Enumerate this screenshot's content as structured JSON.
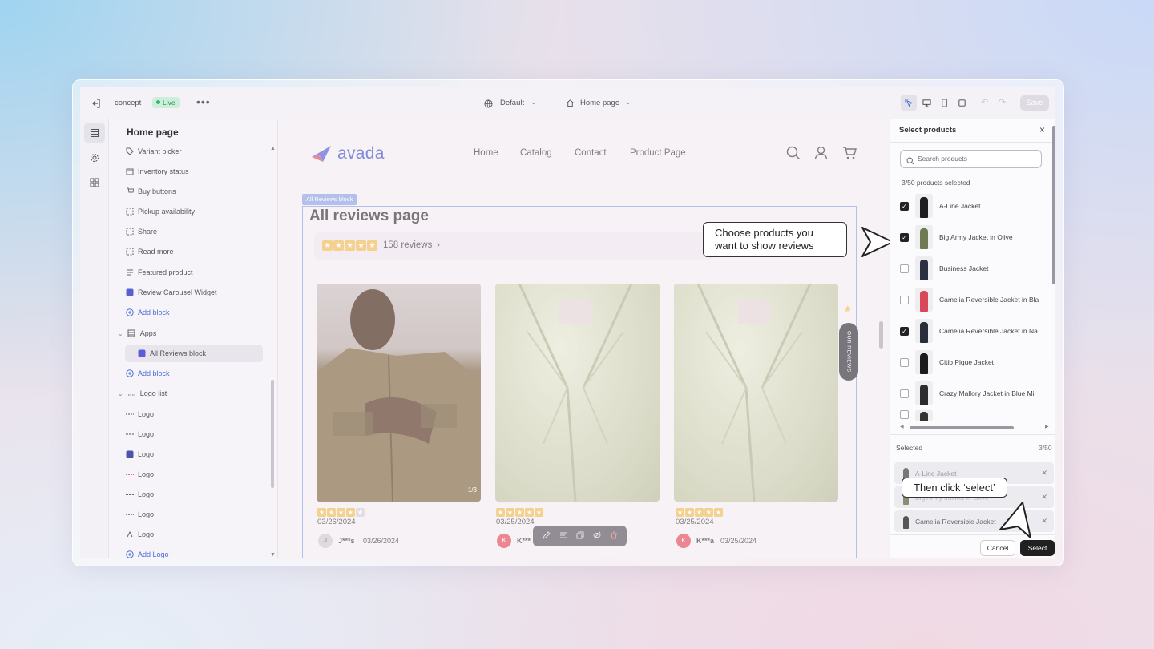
{
  "topbar": {
    "store_name": "concept",
    "live_badge": "Live",
    "more": "•••",
    "theme_select": "Default",
    "page_select": "Home page",
    "save_label": "Save"
  },
  "tree": {
    "title": "Home page",
    "items": [
      {
        "label": "Variant picker",
        "icon": "tag-icon"
      },
      {
        "label": "Inventory status",
        "icon": "box-icon"
      },
      {
        "label": "Buy buttons",
        "icon": "cart-icon"
      },
      {
        "label": "Pickup availability",
        "icon": "dashed-square-icon"
      },
      {
        "label": "Share",
        "icon": "dashed-square-icon"
      },
      {
        "label": "Read more",
        "icon": "dashed-square-icon"
      },
      {
        "label": "Featured product",
        "icon": "lines-icon"
      },
      {
        "label": "Review Carousel Widget",
        "icon": "app-icon"
      },
      {
        "label": "Add block",
        "icon": "plus-circle-icon"
      }
    ],
    "apps_label": "Apps",
    "apps_items": [
      {
        "label": "All Reviews block",
        "icon": "app-icon"
      },
      {
        "label": "Add block",
        "icon": "plus-circle-icon"
      }
    ],
    "logo_list_label": "Logo list",
    "logo_items": [
      "Logo",
      "Logo",
      "Logo",
      "Logo",
      "Logo",
      "Logo",
      "Logo"
    ],
    "add_logo": "Add Logo"
  },
  "canvas": {
    "brand": "avada",
    "nav": [
      "Home",
      "Catalog",
      "Contact",
      "Product Page"
    ],
    "block_tag": "All Reviews block",
    "page_heading": "All reviews page",
    "reviews_count": "158 reviews",
    "cards": [
      {
        "date": "03/26/2024",
        "avatar": "J",
        "name": "J***s",
        "name_date": "03/26/2024",
        "stars": 4,
        "counter": "1/3"
      },
      {
        "date": "03/25/2024",
        "avatar": "K",
        "name": "K***",
        "name_date": "",
        "stars": 5,
        "counter": ""
      },
      {
        "date": "03/25/2024",
        "avatar": "K",
        "name": "K***a",
        "name_date": "03/25/2024",
        "stars": 5,
        "counter": ""
      }
    ],
    "our_reviews_tab": "OUR REVIEWS",
    "callout_choose": "Choose products you\nwant to show reviews",
    "callout_select": "Then click ‘select’"
  },
  "panel": {
    "title": "Select products",
    "search_placeholder": "Search products",
    "selected_count": "3/50 products selected",
    "products": [
      {
        "name": "A-Line Jacket",
        "checked": true,
        "color": "#1f1f22"
      },
      {
        "name": "Big Army Jacket in Olive",
        "checked": true,
        "color": "#6f7a52"
      },
      {
        "name": "Business Jacket",
        "checked": false,
        "color": "#2b3040"
      },
      {
        "name": "Camelia Reversible Jacket in Bla",
        "checked": false,
        "color": "#d9475a"
      },
      {
        "name": "Camelia Reversible Jacket in Na",
        "checked": true,
        "color": "#2a2e3a"
      },
      {
        "name": "Citib Pique Jacket",
        "checked": false,
        "color": "#1b1b1d"
      },
      {
        "name": "Crazy Mallory Jacket in Blue Mi",
        "checked": false,
        "color": "#2b2b30"
      }
    ],
    "selected_label": "Selected",
    "selected_total": "3/50",
    "selected_items": [
      "A-Line Jacket",
      "Big Army Jacket in Olive",
      "Camelia Reversible Jacket"
    ],
    "cancel": "Cancel",
    "select": "Select"
  },
  "colors": {
    "accent": "#4a6fd6",
    "live_bg": "#cdeedb",
    "star": "#f2c46d",
    "primary_button": "#202020"
  }
}
